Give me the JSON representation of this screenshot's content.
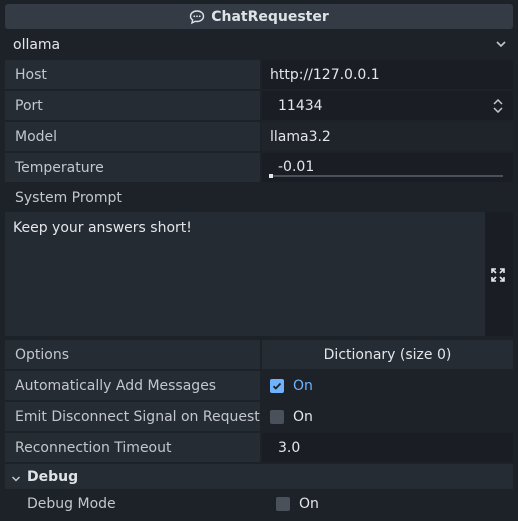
{
  "header": {
    "title": "ChatRequester",
    "icon": "chat-bubble-icon"
  },
  "provider": {
    "selected": "ollama"
  },
  "properties": {
    "host": {
      "label": "Host",
      "value": "http://127.0.0.1"
    },
    "port": {
      "label": "Port",
      "value": "11434"
    },
    "model": {
      "label": "Model",
      "value": "llama3.2"
    },
    "temperature": {
      "label": "Temperature",
      "value": "-0.01",
      "slider_fraction": 0.0
    },
    "system_prompt": {
      "label": "System Prompt",
      "value": "Keep your answers short!"
    },
    "options": {
      "label": "Options",
      "value": "Dictionary (size 0)"
    },
    "auto_add": {
      "label": "Automatically Add Messages",
      "checked": true,
      "value": "On"
    },
    "emit_disconnect": {
      "label": "Emit Disconnect Signal on Request",
      "checked": false,
      "value": "On"
    },
    "reconnection_timeout": {
      "label": "Reconnection Timeout",
      "value": "3.0"
    }
  },
  "debug": {
    "section_label": "Debug",
    "debug_mode": {
      "label": "Debug Mode",
      "checked": false,
      "value": "On"
    }
  },
  "colors": {
    "accent": "#6fb3ff",
    "background": "#1d2229"
  }
}
